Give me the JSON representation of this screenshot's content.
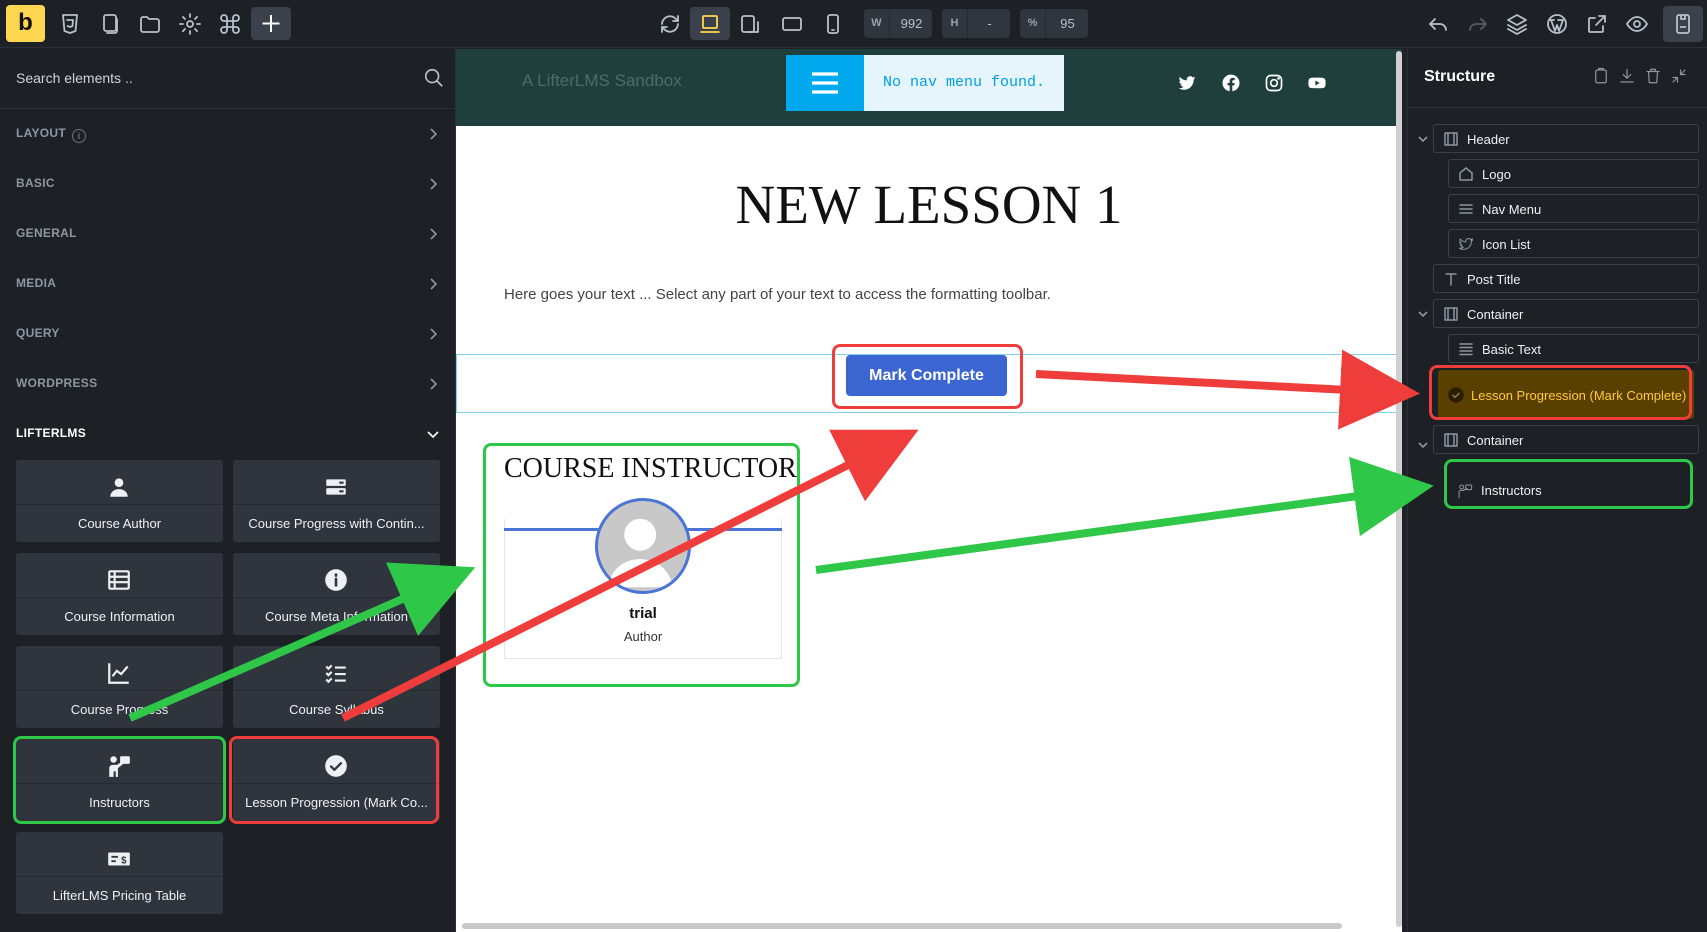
{
  "toolbar": {
    "logo_letter": "b",
    "width_label": "W",
    "width_value": "992",
    "height_label": "H",
    "height_value": "-",
    "zoom_label": "%",
    "zoom_value": "95"
  },
  "sidebar": {
    "search_placeholder": "Search elements ..",
    "categories": [
      {
        "label": "LAYOUT"
      },
      {
        "label": "BASIC"
      },
      {
        "label": "GENERAL"
      },
      {
        "label": "MEDIA"
      },
      {
        "label": "QUERY"
      },
      {
        "label": "WORDPRESS"
      },
      {
        "label": "LIFTERLMS"
      }
    ],
    "elements": [
      {
        "label": "Course Author",
        "icon": "person-icon"
      },
      {
        "label": "Course Progress with Contin...",
        "icon": "progress-bars-icon"
      },
      {
        "label": "Course Information",
        "icon": "table-icon"
      },
      {
        "label": "Course Meta Information",
        "icon": "info-icon"
      },
      {
        "label": "Course Progress",
        "icon": "line-chart-icon"
      },
      {
        "label": "Course Syllabus",
        "icon": "checklist-icon"
      },
      {
        "label": "Instructors",
        "icon": "teacher-icon"
      },
      {
        "label": "Lesson Progression (Mark Co...",
        "icon": "check-circle-icon"
      },
      {
        "label": "LifterLMS Pricing Table",
        "icon": "money-icon"
      }
    ]
  },
  "canvas": {
    "site_title": "A LifterLMS Sandbox",
    "nav_message": "No nav menu found.",
    "post_title": "NEW LESSON 1",
    "basic_text": "Here goes your text ... Select any part of your text to access the formatting toolbar.",
    "mark_complete": "Mark Complete",
    "instructor_heading": "COURSE INSTRUCTOR",
    "instructor_name": "trial",
    "instructor_role": "Author"
  },
  "structure": {
    "title": "Structure",
    "nodes": [
      {
        "label": "Header",
        "icon": "section-icon"
      },
      {
        "label": "Logo",
        "icon": "home-icon"
      },
      {
        "label": "Nav Menu",
        "icon": "menu-icon"
      },
      {
        "label": "Icon List",
        "icon": "twitter-icon"
      },
      {
        "label": "Post Title",
        "icon": "text-t-icon"
      },
      {
        "label": "Container",
        "icon": "section-icon"
      },
      {
        "label": "Basic Text",
        "icon": "lines-icon"
      },
      {
        "label": "Lesson Progression (Mark Complete)",
        "icon": "check-circle-icon"
      },
      {
        "label": "Container",
        "icon": "section-icon"
      },
      {
        "label": "Instructors",
        "icon": "teacher-icon"
      }
    ]
  },
  "annotations": {
    "red_color": "#ee3d3b",
    "green_color": "#2fc748"
  }
}
